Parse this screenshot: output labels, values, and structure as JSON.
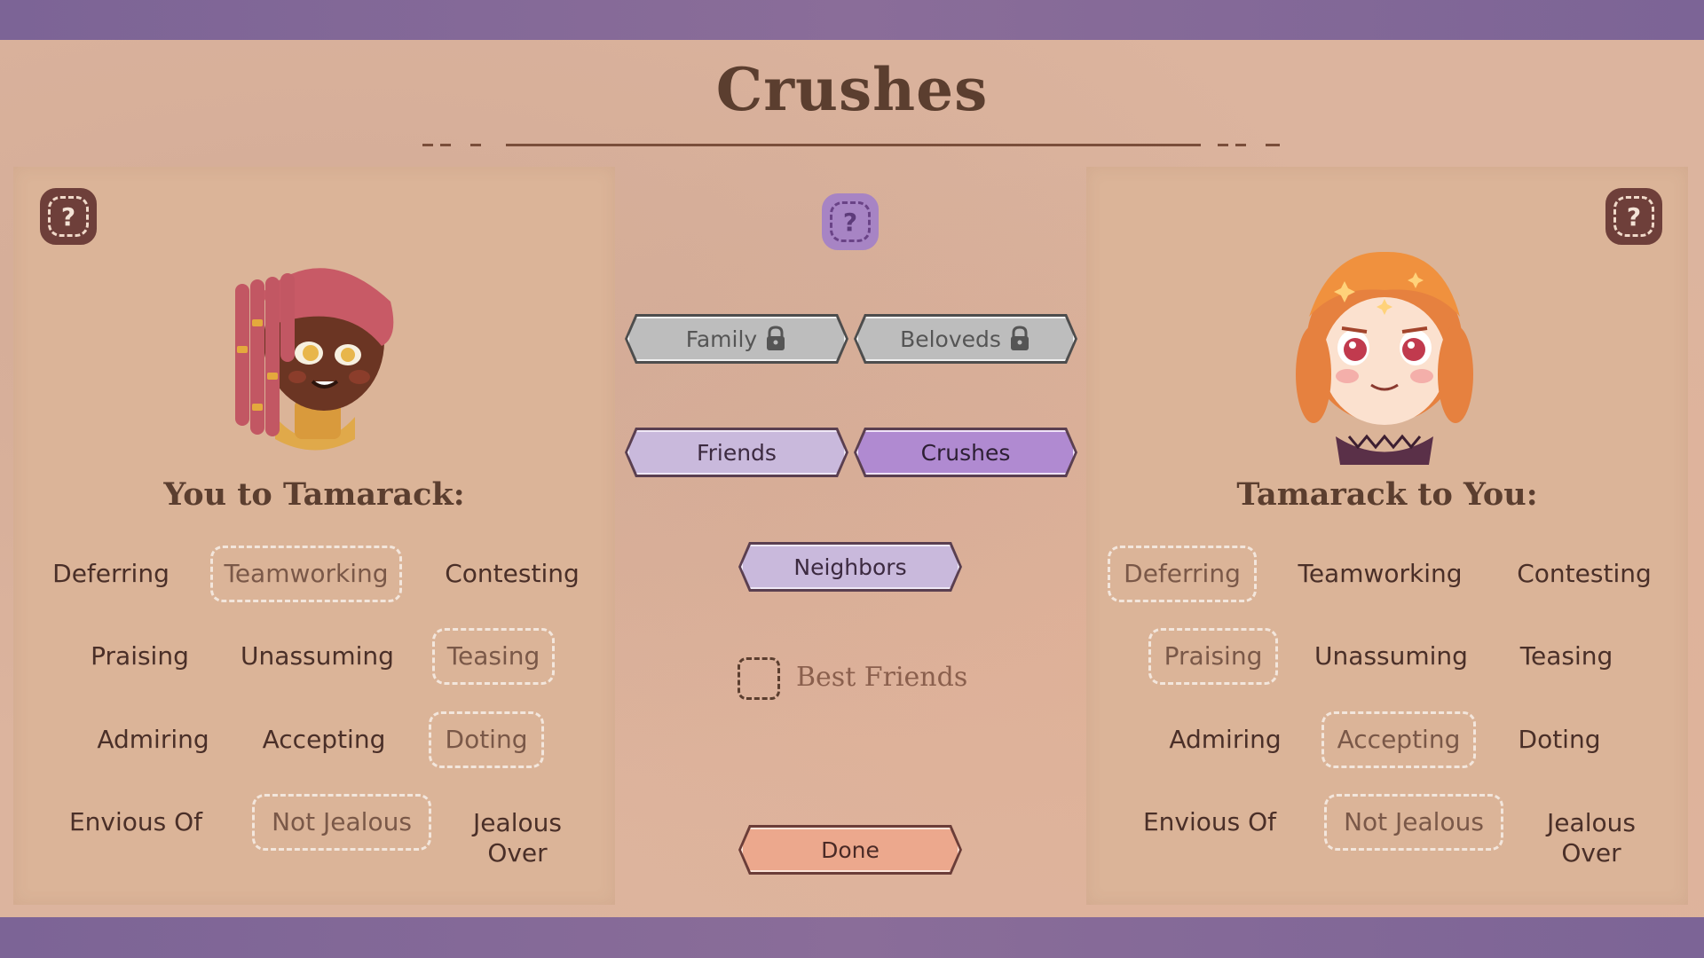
{
  "screen": {
    "title": "Crushes"
  },
  "left_panel": {
    "heading": "You to Tamarack:",
    "help_icon": "question-icon",
    "traits": [
      {
        "label": "Deferring",
        "selected": false
      },
      {
        "label": "Teamworking",
        "selected": true
      },
      {
        "label": "Contesting",
        "selected": false
      },
      {
        "label": "Praising",
        "selected": false
      },
      {
        "label": "Unassuming",
        "selected": false
      },
      {
        "label": "Teasing",
        "selected": true
      },
      {
        "label": "Admiring",
        "selected": false
      },
      {
        "label": "Accepting",
        "selected": false
      },
      {
        "label": "Doting",
        "selected": true
      },
      {
        "label": "Envious Of",
        "selected": false
      },
      {
        "label": "Not Jealous",
        "selected": true
      },
      {
        "label": "Jealous Over",
        "selected": false
      }
    ]
  },
  "right_panel": {
    "heading": "Tamarack to You:",
    "help_icon": "question-icon",
    "traits": [
      {
        "label": "Deferring",
        "selected": true
      },
      {
        "label": "Teamworking",
        "selected": false
      },
      {
        "label": "Contesting",
        "selected": false
      },
      {
        "label": "Praising",
        "selected": true
      },
      {
        "label": "Unassuming",
        "selected": false
      },
      {
        "label": "Teasing",
        "selected": false
      },
      {
        "label": "Admiring",
        "selected": false
      },
      {
        "label": "Accepting",
        "selected": true
      },
      {
        "label": "Doting",
        "selected": false
      },
      {
        "label": "Envious Of",
        "selected": false
      },
      {
        "label": "Not Jealous",
        "selected": true
      },
      {
        "label": "Jealous Over",
        "selected": false
      }
    ]
  },
  "center": {
    "help_icon": "question-icon",
    "buttons": {
      "family": {
        "label": "Family",
        "state": "locked"
      },
      "beloveds": {
        "label": "Beloveds",
        "state": "locked"
      },
      "friends": {
        "label": "Friends",
        "state": "available"
      },
      "crushes": {
        "label": "Crushes",
        "state": "active"
      },
      "neighbors": {
        "label": "Neighbors",
        "state": "available"
      }
    },
    "best_friends": {
      "label": "Best Friends",
      "checked": false
    },
    "done_label": "Done"
  },
  "colors": {
    "accent_purple": "#b08ad1",
    "brand_band": "#7c6496",
    "done_button": "#eca88d",
    "text_brown": "#5b3e2f"
  }
}
